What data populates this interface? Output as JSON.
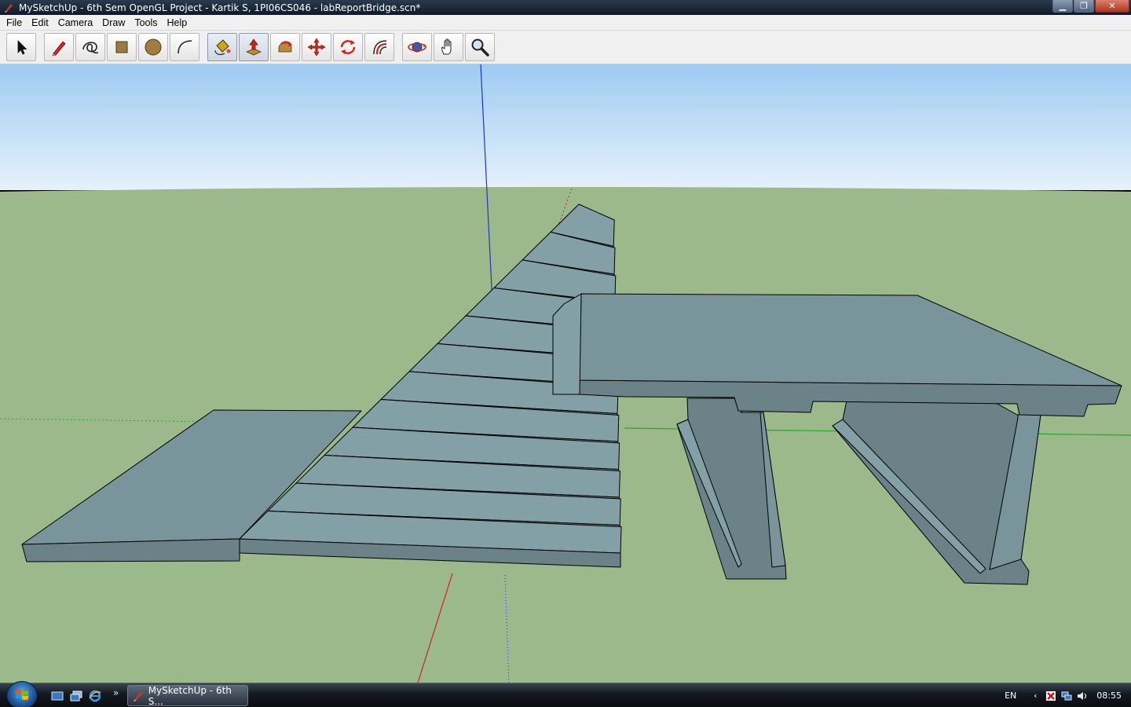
{
  "window": {
    "title": "MySketchUp - 6th Sem OpenGL Project - Kartik S, 1PI06CS046 - labReportBridge.scn*",
    "controls": {
      "minimize": "▁",
      "restore": "❐",
      "close": "✕"
    }
  },
  "menu": {
    "items": [
      {
        "label": "File"
      },
      {
        "label": "Edit"
      },
      {
        "label": "Camera"
      },
      {
        "label": "Draw"
      },
      {
        "label": "Tools"
      },
      {
        "label": "Help"
      }
    ]
  },
  "toolbar": {
    "tools": [
      {
        "id": "select",
        "icon": "arrow-cursor-icon",
        "pressed": false
      },
      {
        "id": "line",
        "icon": "pencil-icon",
        "pressed": false
      },
      {
        "id": "freehand",
        "icon": "freehand-scribble-icon",
        "pressed": false
      },
      {
        "id": "rectangle",
        "icon": "rectangle-icon",
        "pressed": false
      },
      {
        "id": "circle",
        "icon": "circle-icon",
        "pressed": false
      },
      {
        "id": "arc",
        "icon": "arc-icon",
        "pressed": false
      },
      {
        "id": "paint",
        "icon": "paint-bucket-icon",
        "pressed": true
      },
      {
        "id": "push-pull",
        "icon": "push-pull-icon",
        "pressed": true
      },
      {
        "id": "follow-me",
        "icon": "follow-me-icon",
        "pressed": false
      },
      {
        "id": "move",
        "icon": "move-icon",
        "pressed": false
      },
      {
        "id": "rotate",
        "icon": "rotate-icon",
        "pressed": false
      },
      {
        "id": "offset",
        "icon": "offset-icon",
        "pressed": false
      },
      {
        "id": "orbit",
        "icon": "orbit-icon",
        "pressed": false
      },
      {
        "id": "pan",
        "icon": "pan-hand-icon",
        "pressed": false
      },
      {
        "id": "zoom",
        "icon": "zoom-magnifier-icon",
        "pressed": false
      }
    ]
  },
  "viewport": {
    "colors": {
      "sky_top": "#9ecbf2",
      "sky_bottom": "#e6f1fb",
      "ground": "#9bb98a",
      "model_face": "#7a949b",
      "model_face_dark": "#6b8289",
      "model_face_light": "#84a0a7",
      "edge": "#000000",
      "axis_red": "#cc2222",
      "axis_green": "#22aa22",
      "axis_blue": "#2233cc"
    },
    "stairs": {
      "steps": 12
    }
  },
  "taskbar": {
    "task_label": "MySketchUp - 6th S...",
    "language": "EN",
    "time": "08:55"
  }
}
